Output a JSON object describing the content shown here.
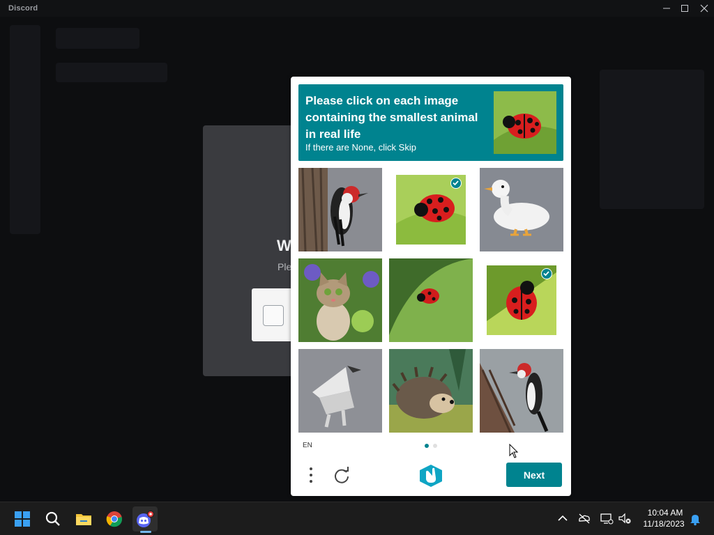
{
  "window": {
    "title": "Discord"
  },
  "verify": {
    "title": "W",
    "subtitle": "Ple"
  },
  "captcha": {
    "prompt": "Please click on each image containing the smallest animal in real life",
    "prompt_sub": "If there are None, click Skip",
    "example_icon": "ladybug-icon",
    "tiles": [
      {
        "name": "woodpecker",
        "selected": false
      },
      {
        "name": "ladybug",
        "selected": true
      },
      {
        "name": "duck",
        "selected": false
      },
      {
        "name": "cat",
        "selected": false
      },
      {
        "name": "ladybug",
        "selected": false
      },
      {
        "name": "ladybug",
        "selected": true
      },
      {
        "name": "origami-bird",
        "selected": false
      },
      {
        "name": "hedgehog",
        "selected": false
      },
      {
        "name": "woodpecker",
        "selected": false
      }
    ],
    "language": "EN",
    "page_current": 1,
    "page_total": 2,
    "next_label": "Next",
    "accent": "#00838f"
  },
  "taskbar": {
    "apps": [
      "windows-start-icon",
      "search-icon",
      "file-explorer-icon",
      "chrome-icon",
      "discord-icon"
    ],
    "time": "10:04 AM",
    "date": "11/18/2023"
  }
}
